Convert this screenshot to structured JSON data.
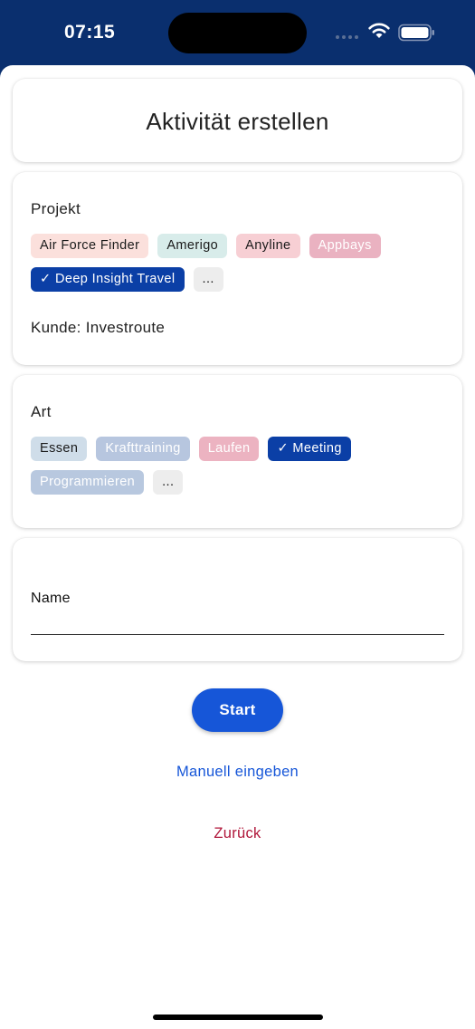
{
  "status": {
    "time": "07:15",
    "wifi_icon": "wifi-icon",
    "battery_icon": "battery-icon"
  },
  "title": "Aktivität erstellen",
  "project": {
    "label": "Projekt",
    "chips": [
      {
        "label": "Air Force Finder",
        "bg": "#fbe0dc",
        "selected": false
      },
      {
        "label": "Amerigo",
        "bg": "#d8ecea",
        "selected": false
      },
      {
        "label": "Anyline",
        "bg": "#f7cfd4",
        "selected": false
      },
      {
        "label": "Appbays",
        "bg": "#eab2c1",
        "selected": false,
        "text": "#ffffff"
      },
      {
        "label": "✓ Deep Insight Travel",
        "bg": "#0b3fa6",
        "selected": true
      },
      {
        "label": "...",
        "bg": "#ededed",
        "selected": false
      }
    ],
    "customer": "Kunde: Investroute"
  },
  "type": {
    "label": "Art",
    "chips": [
      {
        "label": "Essen",
        "bg": "#cfdde9",
        "selected": false
      },
      {
        "label": "Krafttraining",
        "bg": "#b7c6df",
        "selected": false,
        "text": "#ffffff"
      },
      {
        "label": "Laufen",
        "bg": "#ecb3c1",
        "selected": false,
        "text": "#ffffff"
      },
      {
        "label": "✓ Meeting",
        "bg": "#0b3fa6",
        "selected": true
      },
      {
        "label": "Programmieren",
        "bg": "#b8c8df",
        "selected": false,
        "text": "#ffffff"
      },
      {
        "label": "...",
        "bg": "#ededed",
        "selected": false
      }
    ]
  },
  "name_field": {
    "label": "Name",
    "value": ""
  },
  "actions": {
    "start": "Start",
    "manual": "Manuell eingeben",
    "back": "Zurück"
  },
  "colors": {
    "header_bg": "#0a2f6e",
    "accent": "#1656d8",
    "danger": "#b0163a"
  }
}
